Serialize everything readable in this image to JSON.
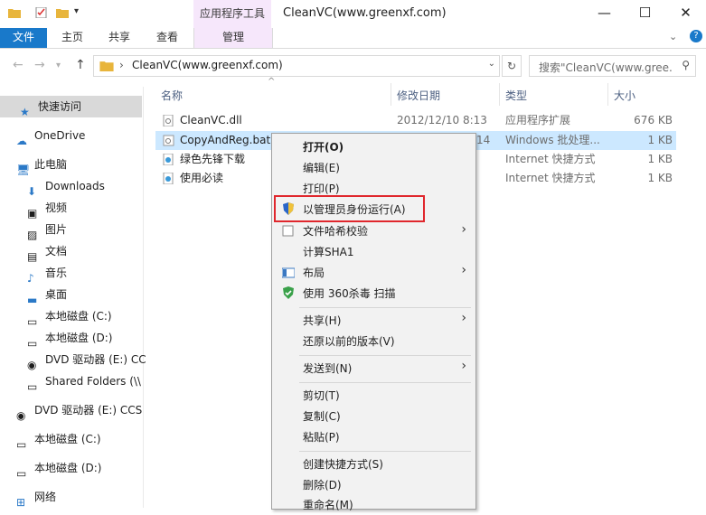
{
  "window": {
    "title": "CleanVC(www.greenxf.com)",
    "context_tab_title": "应用程序工具",
    "controls": [
      "—",
      "☐",
      "✕"
    ]
  },
  "ribbon": {
    "tabs": [
      "文件",
      "主页",
      "共享",
      "查看",
      "管理"
    ]
  },
  "address": {
    "path": "CleanVC(www.greenxf.com)",
    "search_placeholder": "搜索\"CleanVC(www.gree..."
  },
  "nav": {
    "items": [
      {
        "label": "快速访问",
        "icon": "star-icon"
      },
      {
        "label": "OneDrive",
        "icon": "cloud-icon"
      },
      {
        "label": "此电脑",
        "icon": "computer-icon"
      },
      {
        "label": "Downloads",
        "icon": "download-icon"
      },
      {
        "label": "视频",
        "icon": "video-icon"
      },
      {
        "label": "图片",
        "icon": "picture-icon"
      },
      {
        "label": "文档",
        "icon": "document-icon"
      },
      {
        "label": "音乐",
        "icon": "music-icon"
      },
      {
        "label": "桌面",
        "icon": "desktop-icon"
      },
      {
        "label": "本地磁盘 (C:)",
        "icon": "drive-icon"
      },
      {
        "label": "本地磁盘 (D:)",
        "icon": "drive-icon"
      },
      {
        "label": "DVD 驱动器 (E:) CC",
        "icon": "dvd-icon"
      },
      {
        "label": "Shared Folders (\\\\",
        "icon": "network-drive-icon"
      },
      {
        "label": "DVD 驱动器 (E:) CCS",
        "icon": "dvd-icon"
      },
      {
        "label": "本地磁盘 (C:)",
        "icon": "drive-icon"
      },
      {
        "label": "本地磁盘 (D:)",
        "icon": "drive-icon"
      },
      {
        "label": "网络",
        "icon": "network-icon"
      }
    ]
  },
  "columns": {
    "name": "名称",
    "date": "修改日期",
    "type": "类型",
    "size": "大小"
  },
  "files": [
    {
      "name": "CleanVC.dll",
      "date": "2012/12/10 8:13",
      "type": "应用程序扩展",
      "size": "676 KB"
    },
    {
      "name": "CopyAndReg.bat",
      "date": "14",
      "type": "Windows 批处理...",
      "size": "1 KB"
    },
    {
      "name": "绿色先锋下载",
      "date": "",
      "type": "Internet 快捷方式",
      "size": "1 KB"
    },
    {
      "name": "使用必读",
      "date": "",
      "type": "Internet 快捷方式",
      "size": "1 KB"
    }
  ],
  "context_menu": {
    "items": [
      {
        "label": "打开(O)"
      },
      {
        "label": "编辑(E)"
      },
      {
        "label": "打印(P)"
      },
      {
        "label": "以管理员身份运行(A)"
      },
      {
        "label": "文件哈希校验"
      },
      {
        "label": "计算SHA1"
      },
      {
        "label": "布局"
      },
      {
        "label": "使用 360杀毒 扫描"
      },
      {
        "label": "共享(H)"
      },
      {
        "label": "还原以前的版本(V)"
      },
      {
        "label": "发送到(N)"
      },
      {
        "label": "剪切(T)"
      },
      {
        "label": "复制(C)"
      },
      {
        "label": "粘贴(P)"
      },
      {
        "label": "创建快捷方式(S)"
      },
      {
        "label": "删除(D)"
      },
      {
        "label": "重命名(M)"
      }
    ]
  },
  "colors": {
    "accent": "#1979ca",
    "selection": "#cce8ff",
    "highlight": "#e0272d",
    "context_tab": "#f6e7fb"
  }
}
